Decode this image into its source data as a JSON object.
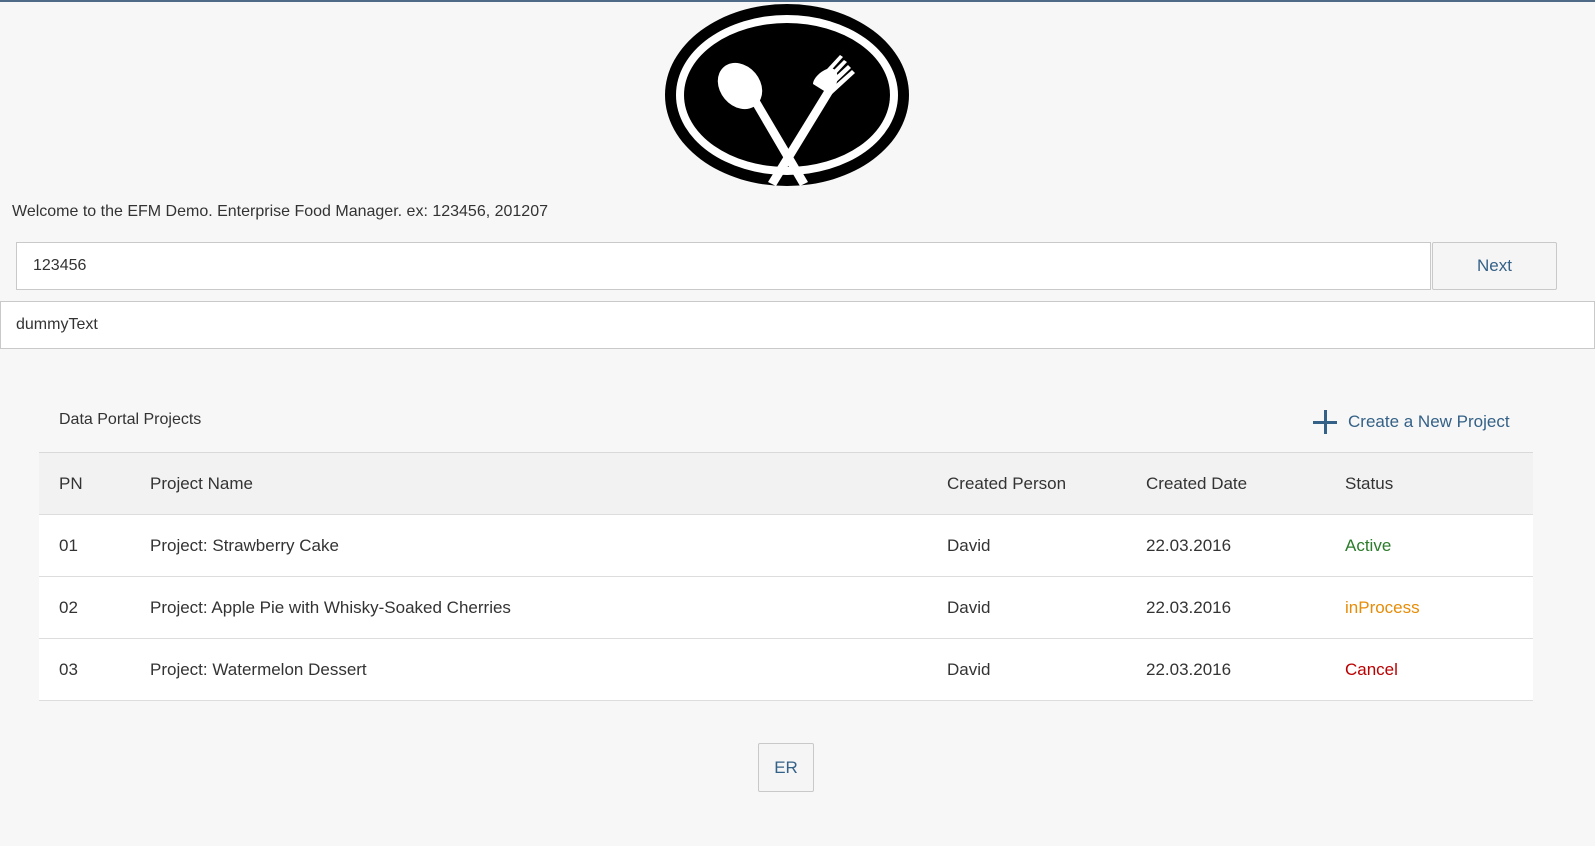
{
  "welcome_text": "Welcome to the EFM Demo. Enterprise Food Manager. ex: 123456, 201207",
  "logo": {
    "icon": "fork-spoon-plate-icon"
  },
  "search": {
    "value": "123456",
    "next_label": "Next"
  },
  "dummy_field": {
    "value": "dummyText"
  },
  "projects": {
    "title": "Data Portal Projects",
    "create_label": "Create a New Project",
    "columns": [
      "PN",
      "Project Name",
      "Created Person",
      "Created Date",
      "Status"
    ],
    "rows": [
      {
        "pn": "01",
        "name": "Project: Strawberry Cake",
        "person": "David",
        "date": "22.03.2016",
        "status": "Active",
        "status_color": "#2b7c2b"
      },
      {
        "pn": "02",
        "name": "Project: Apple Pie with Whisky-Soaked Cherries",
        "person": "David",
        "date": "22.03.2016",
        "status": "inProcess",
        "status_color": "#e78c07"
      },
      {
        "pn": "03",
        "name": "Project: Watermelon Dessert",
        "person": "David",
        "date": "22.03.2016",
        "status": "Cancel",
        "status_color": "#bb0000"
      }
    ]
  },
  "footer": {
    "er_label": "ER"
  },
  "colors": {
    "accent": "#346187",
    "top_border": "#4f6a86"
  }
}
